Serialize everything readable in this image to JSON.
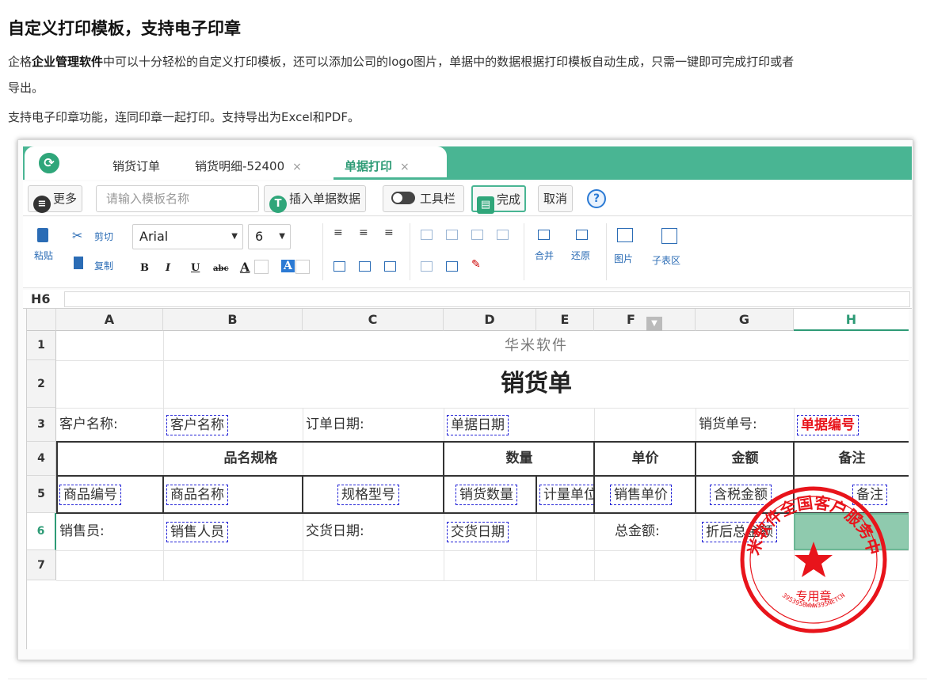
{
  "article": {
    "title": "自定义打印模板，支持电子印章",
    "p1_pre": "企格",
    "p1_bold": "企业管理软件",
    "p1_post": "中可以十分轻松的自定义打印模板，还可以添加公司的logo图片，单据中的数据根据打印模板自动生成，只需一键即可完成打印或者",
    "p1_wrap": "导出。",
    "p2": "支持电子印章功能，连同印章一起打印。支持导出为Excel和PDF。"
  },
  "app": {
    "logo_icon": "refresh-logo-icon",
    "tabs": [
      {
        "label": "销货订单",
        "closable": false
      },
      {
        "label": "销货明细-52400",
        "closable": true
      },
      {
        "label": "单据打印",
        "closable": true,
        "active": true
      }
    ],
    "close_glyph": "×",
    "toolbar": {
      "more": "更多",
      "template_placeholder": "请输入模板名称",
      "insert_data": "插入单据数据",
      "toolbar_toggle": "工具栏",
      "done": "完成",
      "cancel": "取消",
      "help": "?"
    },
    "ribbon": {
      "paste": "粘贴",
      "cut": "剪切",
      "copy": "复制",
      "font": "Arial",
      "font_size": "6",
      "bold": "B",
      "italic": "I",
      "underline": "U",
      "strike": "abc",
      "font_color": "A",
      "bg_color": "A",
      "merge": "合并",
      "restore": "还原",
      "image": "图片",
      "subtable": "子表区"
    },
    "formula": {
      "cell_ref": "H6"
    },
    "columns": [
      "A",
      "B",
      "C",
      "D",
      "E",
      "F",
      "G",
      "H"
    ],
    "active_column": "H",
    "rows": [
      "1",
      "2",
      "3",
      "4",
      "5",
      "6",
      "7"
    ],
    "active_row": "6",
    "sheet": {
      "company": "华米软件",
      "doc_title": "销货单",
      "r3": {
        "customer_label": "客户名称:",
        "customer_field": "客户名称",
        "date_label": "订单日期:",
        "date_field": "单据日期",
        "no_label": "销货单号:",
        "no_field": "单据编号"
      },
      "r4": {
        "spec": "品名规格",
        "qty": "数量",
        "price": "单价",
        "amount": "金额",
        "remark": "备注"
      },
      "r5": {
        "code": "商品编号",
        "name": "商品名称",
        "model": "规格型号",
        "qty": "销货数量",
        "unit": "计量单位",
        "price": "销售单价",
        "amount": "含税金额",
        "remark": "备注"
      },
      "r6": {
        "seller_label": "销售员:",
        "seller_field": "销售人员",
        "delivery_label": "交货日期:",
        "delivery_field": "交货日期",
        "total_label": "总金额:",
        "total_field": "折后总金额"
      }
    },
    "stamp": {
      "top_text": "华米软件全国客户服务中心",
      "center_text": "专用章",
      "bottom_text": "3953958WWW395NETCN",
      "color": "#e8141b"
    },
    "colors": {
      "accent": "#49b593",
      "selected_cell": "#8fcaae",
      "field_red": "#e8141b",
      "field_border": "#2323d6"
    }
  }
}
